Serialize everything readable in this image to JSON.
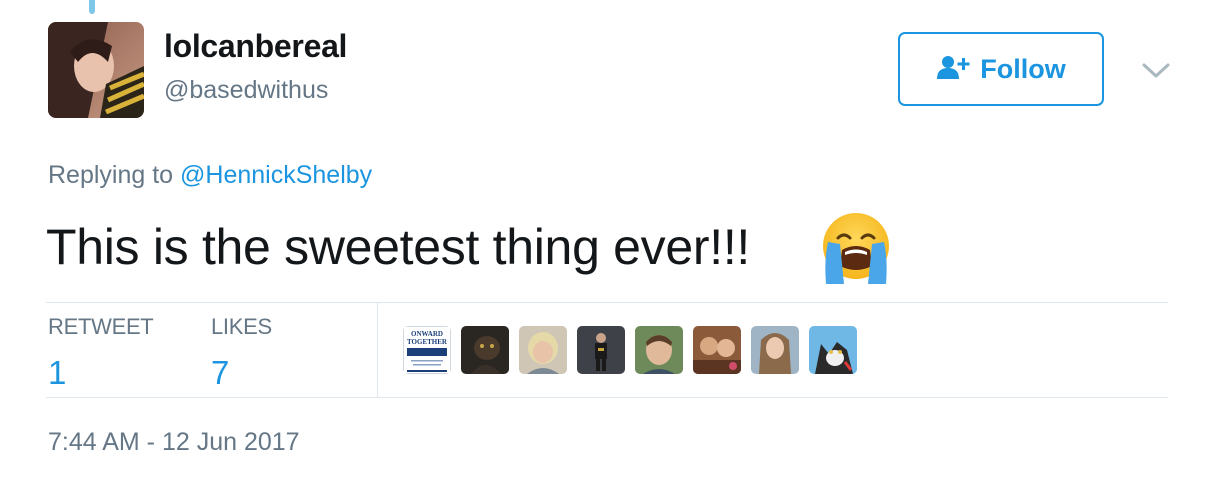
{
  "user": {
    "display_name": "lolcanbereal",
    "handle": "@basedwithus"
  },
  "follow_button": {
    "label": "Follow",
    "icon": "follow-person-plus-icon"
  },
  "menu_icon": "chevron-down-icon",
  "reply": {
    "prefix": "Replying to ",
    "mention": "@HennickShelby"
  },
  "tweet": {
    "text": "This is the sweetest thing ever!!!",
    "emoji": "loudly-crying-face-emoji"
  },
  "stats": {
    "retweets": {
      "label": "RETWEET",
      "count": "1"
    },
    "likes": {
      "label": "LIKES",
      "count": "7"
    }
  },
  "likers": [
    {
      "type": "logo",
      "lines": [
        "ONWARD",
        "TOGETHER"
      ]
    },
    {
      "type": "photo"
    },
    {
      "type": "photo"
    },
    {
      "type": "photo"
    },
    {
      "type": "photo"
    },
    {
      "type": "photo"
    },
    {
      "type": "photo"
    },
    {
      "type": "photo"
    }
  ],
  "timestamp": "7:44 AM - 12 Jun 2017",
  "colors": {
    "link_blue": "#1b95e0",
    "text_dark": "#14171a",
    "text_grey": "#657786",
    "divider": "#e1e8ed"
  }
}
